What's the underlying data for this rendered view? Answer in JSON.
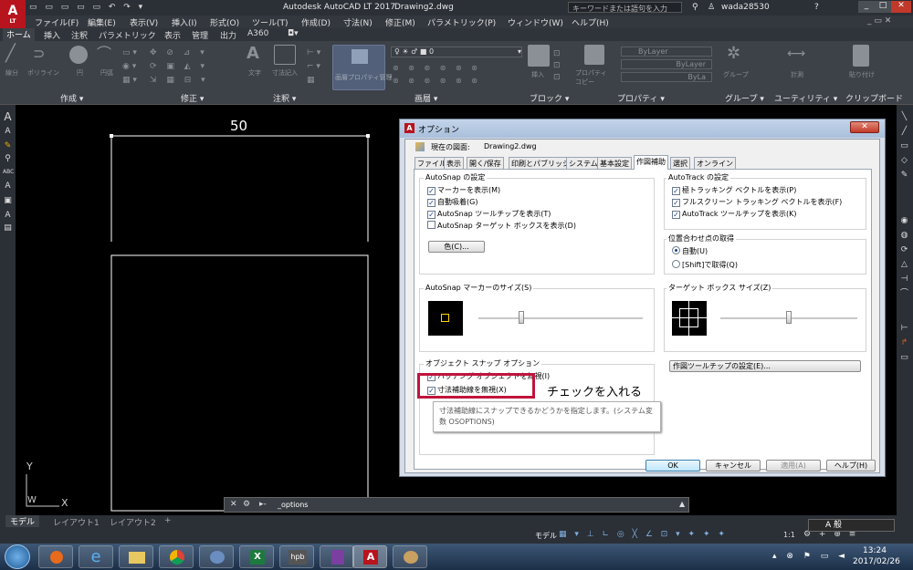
{
  "app": {
    "title": "Autodesk AutoCAD LT 2017",
    "document": "Drawing2.dwg",
    "search_placeholder": "キーワードまたは語句を入力",
    "user": "wada28530",
    "logo_sub": "LT"
  },
  "menu": [
    "ファイル(F)",
    "編集(E)",
    "表示(V)",
    "挿入(I)",
    "形式(O)",
    "ツール(T)",
    "作成(D)",
    "寸法(N)",
    "修正(M)",
    "パラメトリック(P)",
    "ウィンドウ(W)",
    "ヘルプ(H)"
  ],
  "ribbon_tabs": [
    "ホーム",
    "挿入",
    "注釈",
    "パラメトリック",
    "表示",
    "管理",
    "出力",
    "A360"
  ],
  "ribbon_panels": [
    "作成 ▾",
    "修正 ▾",
    "注釈 ▾",
    "画層 ▾",
    "ブロック ▾",
    "プロパティ ▾",
    "グループ ▾",
    "ユーティリティ ▾",
    "クリップボード"
  ],
  "ribbon_labels": {
    "line": "線分",
    "polyline": "ポリライン",
    "circle": "円",
    "arc": "円弧",
    "text": "文字",
    "dimension": "寸法記入",
    "layer_props": "画層プロパティ管理",
    "insert": "挿入",
    "properties_copy": "プロパティコピー",
    "group": "グループ",
    "measure": "計測",
    "paste": "貼り付け",
    "bylayer1": "ByLayer",
    "bylayer2": "ByLayer",
    "bylayer3": "ByLa",
    "layer_name": "0"
  },
  "drawing": {
    "dim_value": "50",
    "ucs_y": "Y",
    "ucs_w": "W",
    "ucs_x": "X"
  },
  "command_line": {
    "value": "_options"
  },
  "layout_tabs": [
    "モデル",
    "レイアウト1",
    "レイアウト2",
    "+"
  ],
  "status": {
    "model": "モデル",
    "scale": "1:1",
    "ime": "A 般"
  },
  "taskbar": {
    "time": "13:24",
    "date": "2017/02/26",
    "hpb": "hpb"
  },
  "dialog": {
    "title": "オプション",
    "current_drawing_label": "現在の図面:",
    "current_drawing": "Drawing2.dwg",
    "tabs": [
      "ファイル",
      "表示",
      "開く/保存",
      "印刷とパブリッシュ",
      "システム",
      "基本設定",
      "作図補助",
      "選択",
      "オンライン"
    ],
    "active_tab": "作図補助",
    "autosnap": {
      "title": "AutoSnap の設定",
      "items": [
        {
          "label": "マーカーを表示(M)",
          "checked": true
        },
        {
          "label": "自動吸着(G)",
          "checked": true
        },
        {
          "label": "AutoSnap ツールチップを表示(T)",
          "checked": true
        },
        {
          "label": "AutoSnap ターゲット ボックスを表示(D)",
          "checked": false
        }
      ],
      "color_button": "色(C)..."
    },
    "autotrack": {
      "title": "AutoTrack の設定",
      "items": [
        {
          "label": "極トラッキング ベクトルを表示(P)",
          "checked": true
        },
        {
          "label": "フルスクリーン トラッキング ベクトルを表示(F)",
          "checked": true
        },
        {
          "label": "AutoTrack ツールチップを表示(K)",
          "checked": true
        }
      ]
    },
    "alignment": {
      "title": "位置合わせ点の取得",
      "options": [
        {
          "label": "自動(U)",
          "selected": true
        },
        {
          "label": "[Shift]で取得(Q)",
          "selected": false
        }
      ]
    },
    "marker_size": {
      "title": "AutoSnap マーカーのサイズ(S)",
      "level": 0.25
    },
    "aperture_size": {
      "title": "ターゲット ボックス サイズ(Z)",
      "level": 0.5
    },
    "object_snap": {
      "title": "オブジェクト スナップ オプション",
      "items": [
        {
          "label": "ハッチング オブジェクトを無視(I)",
          "checked": true
        },
        {
          "label": "寸法補助線を無視(X)",
          "checked": true
        }
      ]
    },
    "tooltip_settings_button": "作図ツールチップの設定(E)...",
    "tooltip_text": "寸法補助線にスナップできるかどうかを指定します。(システム変数 OSOPTIONS)",
    "annotation": "チェックを入れる",
    "buttons": {
      "ok": "OK",
      "cancel": "キャンセル",
      "apply": "適用(A)",
      "help": "ヘルプ(H)"
    },
    "colors": {
      "highlight": "#c0143c",
      "marker": "#ffd700"
    }
  }
}
